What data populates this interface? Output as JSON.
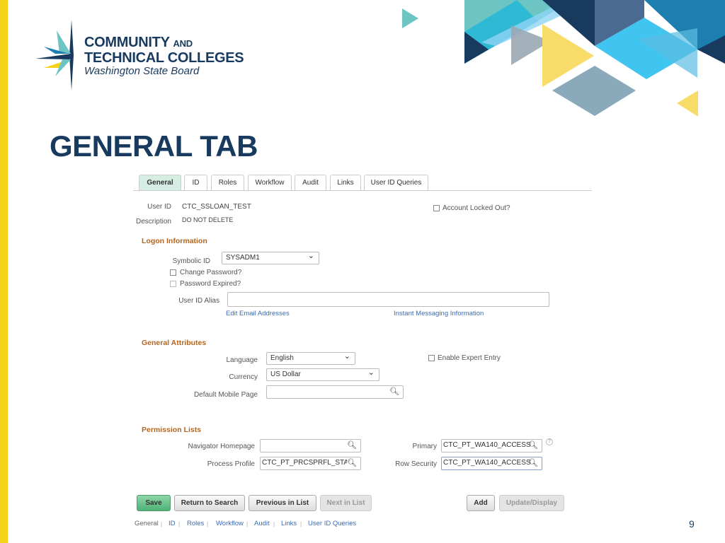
{
  "slide": {
    "title": "GENERAL TAB",
    "page_number": "9",
    "accent_colors": {
      "navy": "#173a5e",
      "yellow": "#f5d21a",
      "teal": "#6cc5c3",
      "blue": "#40c4f0"
    }
  },
  "logo": {
    "line1": "COMMUNITY",
    "line1b": "AND",
    "line2": "TECHNICAL COLLEGES",
    "line3": "Washington State Board"
  },
  "tabs": [
    {
      "label": "General",
      "active": true
    },
    {
      "label": "ID"
    },
    {
      "label": "Roles"
    },
    {
      "label": "Workflow"
    },
    {
      "label": "Audit"
    },
    {
      "label": "Links"
    },
    {
      "label": "User ID Queries"
    }
  ],
  "header": {
    "user_id_label": "User ID",
    "user_id": "CTC_SSLOAN_TEST",
    "description_label": "Description",
    "description": "DO NOT DELETE",
    "account_locked_label": "Account Locked Out?"
  },
  "logon": {
    "heading": "Logon Information",
    "symbolic_id_label": "Symbolic ID",
    "symbolic_id": "SYSADM1",
    "change_password_label": "Change Password?",
    "password_expired_label": "Password Expired?",
    "alias_label": "User ID Alias",
    "alias_value": "",
    "edit_email_link": "Edit Email Addresses",
    "im_link": "Instant Messaging Information"
  },
  "attributes": {
    "heading": "General Attributes",
    "language_label": "Language",
    "language": "English",
    "currency_label": "Currency",
    "currency": "US Dollar",
    "mobile_label": "Default Mobile Page",
    "mobile_value": "",
    "expert_label": "Enable Expert Entry"
  },
  "permissions": {
    "heading": "Permission Lists",
    "nav_label": "Navigator Homepage",
    "nav_value": "",
    "process_label": "Process Profile",
    "process_value": "CTC_PT_PRCSPRFL_STAF",
    "primary_label": "Primary",
    "primary_value": "CTC_PT_WA140_ACCESS",
    "row_label": "Row Security",
    "row_value": "CTC_PT_WA140_ACCESS"
  },
  "buttons": {
    "save": "Save",
    "return": "Return to Search",
    "previous": "Previous in List",
    "next": "Next in List",
    "add": "Add",
    "update": "Update/Display"
  },
  "bottom_links": [
    "General",
    "ID",
    "Roles",
    "Workflow",
    "Audit",
    "Links",
    "User ID Queries"
  ]
}
